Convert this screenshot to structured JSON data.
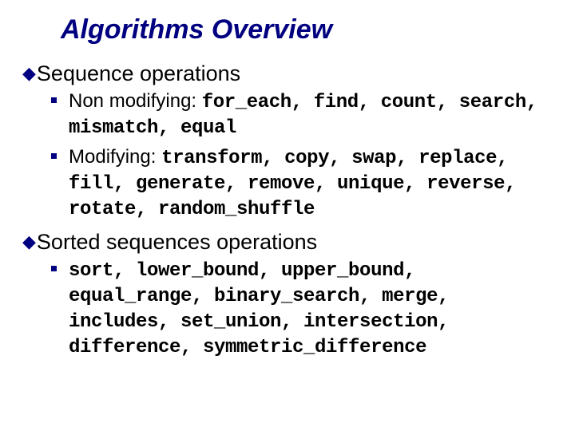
{
  "slide": {
    "title": "Algorithms Overview",
    "sections": [
      {
        "head": "Sequence operations",
        "items": [
          {
            "prefix": "Non modifying: ",
            "code": "for_each, find, count, search, mismatch, equal"
          },
          {
            "prefix": "Modifying: ",
            "code": "transform, copy, swap, replace, fill, generate, remove, unique, reverse, rotate, random_shuffle"
          }
        ]
      },
      {
        "head": "Sorted sequences operations",
        "items": [
          {
            "prefix": "",
            "code": "sort, lower_bound, upper_bound, equal_range, binary_search, merge, includes, set_union, intersection, difference, symmetric_difference"
          }
        ]
      }
    ]
  }
}
